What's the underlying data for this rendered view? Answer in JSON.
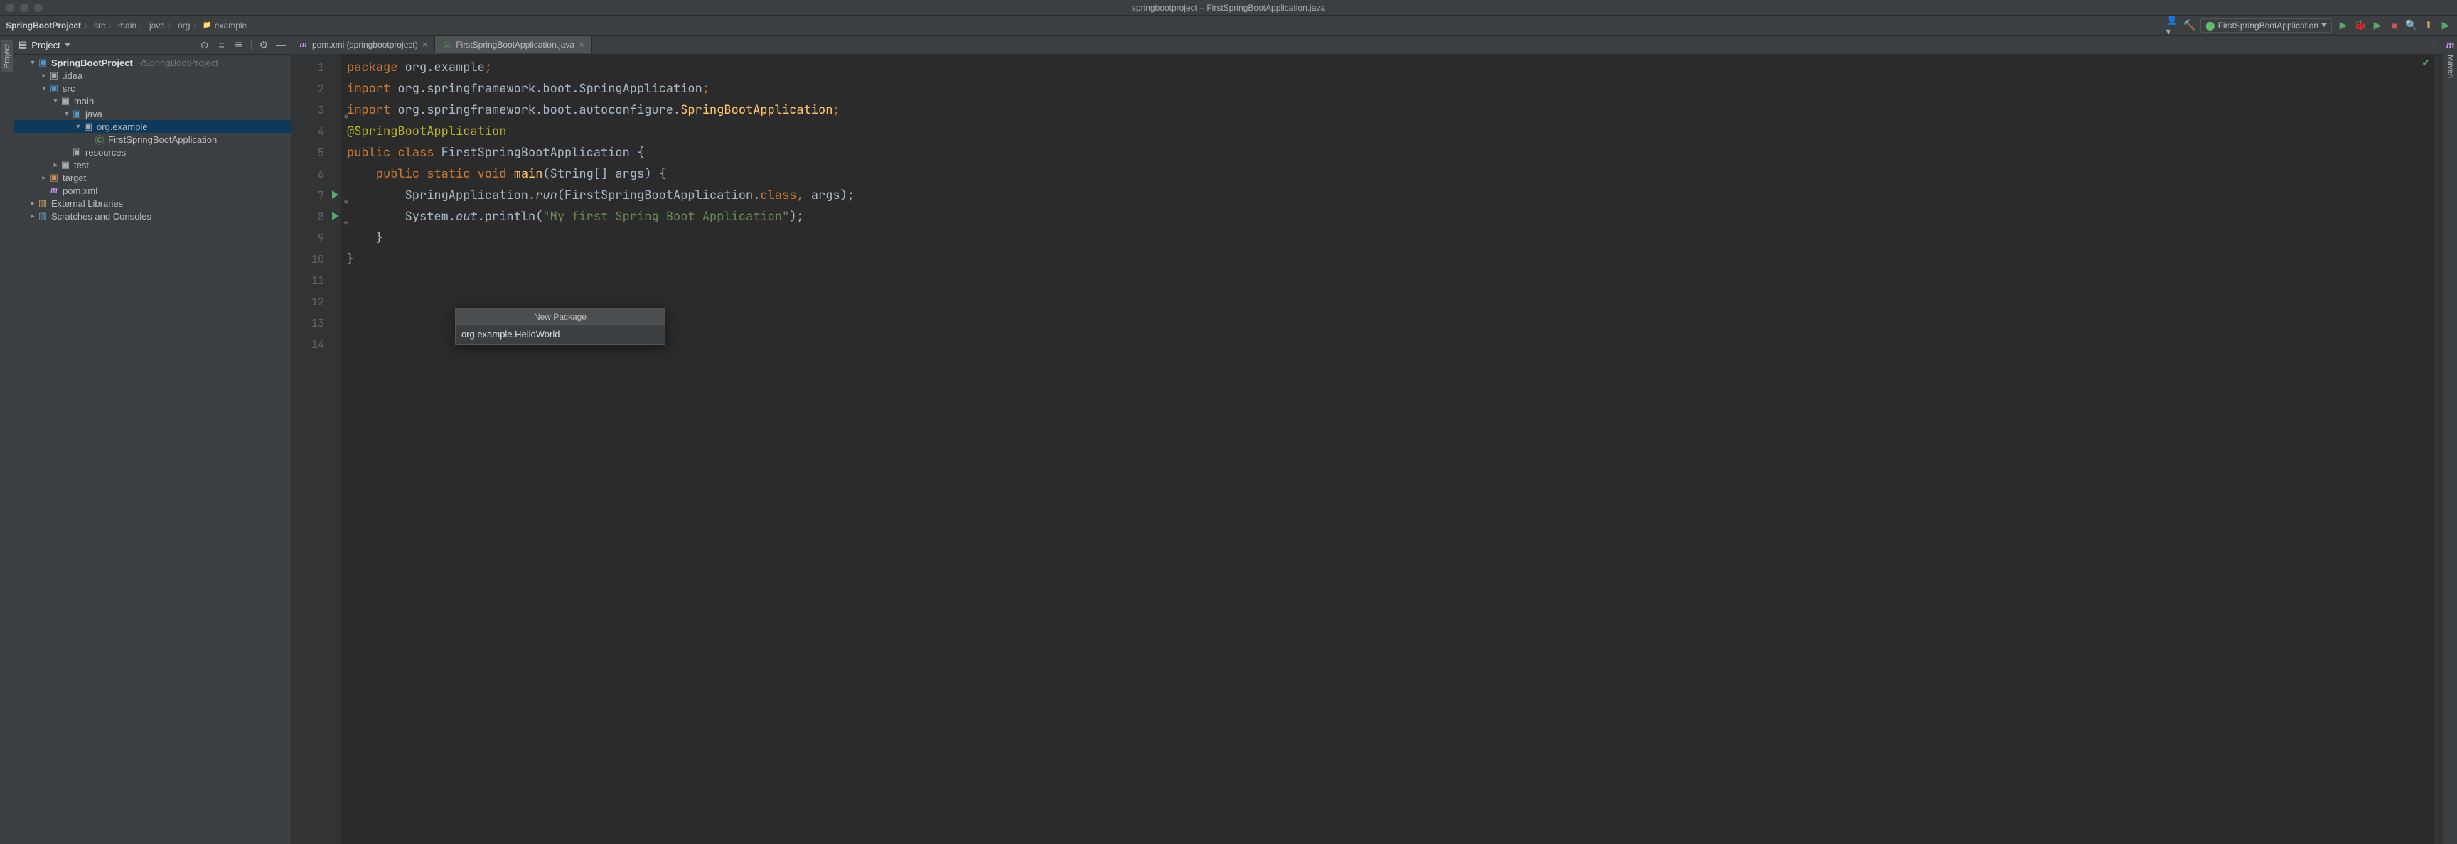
{
  "window": {
    "title": "springbootproject – FirstSpringBootApplication.java"
  },
  "breadcrumb": [
    {
      "label": "SpringBootProject",
      "bold": true
    },
    {
      "label": "src"
    },
    {
      "label": "main"
    },
    {
      "label": "java"
    },
    {
      "label": "org"
    },
    {
      "label": "example",
      "icon": "folder"
    }
  ],
  "run_config": {
    "label": "FirstSpringBootApplication"
  },
  "project_panel": {
    "title": "Project"
  },
  "tree": [
    {
      "depth": 0,
      "toggle": "open",
      "icon": "folder-blue",
      "label": "SpringBootProject",
      "bold": true,
      "hint": "~/SpringBootProject"
    },
    {
      "depth": 1,
      "toggle": "closed",
      "icon": "folder",
      "label": ".idea"
    },
    {
      "depth": 1,
      "toggle": "open",
      "icon": "folder-blue",
      "label": "src"
    },
    {
      "depth": 2,
      "toggle": "open",
      "icon": "folder",
      "label": "main"
    },
    {
      "depth": 3,
      "toggle": "open",
      "icon": "folder-blue",
      "label": "java"
    },
    {
      "depth": 4,
      "toggle": "open",
      "icon": "folder",
      "label": "org.example",
      "sel": true
    },
    {
      "depth": 5,
      "toggle": "",
      "icon": "class",
      "label": "FirstSpringBootApplication"
    },
    {
      "depth": 3,
      "toggle": "",
      "icon": "folder",
      "label": "resources"
    },
    {
      "depth": 2,
      "toggle": "closed",
      "icon": "folder",
      "label": "test"
    },
    {
      "depth": 1,
      "toggle": "closed",
      "icon": "folder-orange",
      "label": "target"
    },
    {
      "depth": 1,
      "toggle": "",
      "icon": "maven",
      "label": "pom.xml"
    },
    {
      "depth": 0,
      "toggle": "closed",
      "icon": "lib",
      "label": "External Libraries"
    },
    {
      "depth": 0,
      "toggle": "closed",
      "icon": "scratch",
      "label": "Scratches and Consoles"
    }
  ],
  "tabs": [
    {
      "label": "pom.xml (springbootproject)",
      "icon": "maven",
      "active": false
    },
    {
      "label": "FirstSpringBootApplication.java",
      "icon": "class",
      "active": true
    }
  ],
  "left_strip": {
    "tab": "Project"
  },
  "right_strip": {
    "tab": "Maven"
  },
  "code": {
    "lines": [
      {
        "n": 1,
        "tokens": [
          {
            "t": "package ",
            "c": "c-kw"
          },
          {
            "t": "org.example",
            "c": "c-pkg"
          },
          {
            "t": ";",
            "c": "c-se"
          }
        ]
      },
      {
        "n": 2,
        "tokens": []
      },
      {
        "n": 3,
        "fold": "⊖",
        "tokens": [
          {
            "t": "import ",
            "c": "c-kw"
          },
          {
            "t": "org.springframework.boot.SpringApplication",
            "c": "c-pkg"
          },
          {
            "t": ";",
            "c": "c-se"
          }
        ]
      },
      {
        "n": 4,
        "tokens": [
          {
            "t": "import ",
            "c": "c-kw"
          },
          {
            "t": "org.springframework.boot.autoconfigure.",
            "c": "c-pkg"
          },
          {
            "t": "SpringBootApplication",
            "c": "c-mnm"
          },
          {
            "t": ";",
            "c": "c-se"
          }
        ]
      },
      {
        "n": 5,
        "tokens": []
      },
      {
        "n": 6,
        "tokens": [
          {
            "t": "@SpringBootApplication",
            "c": "c-ann"
          }
        ]
      },
      {
        "n": 7,
        "run": true,
        "fold": "⊖",
        "tokens": [
          {
            "t": "public class ",
            "c": "c-kw"
          },
          {
            "t": "FirstSpringBootApplication {",
            "c": "c-id"
          }
        ]
      },
      {
        "n": 8,
        "run": true,
        "fold": "⊖",
        "tokens": [
          {
            "t": "    ",
            "c": ""
          },
          {
            "t": "public static void ",
            "c": "c-kw"
          },
          {
            "t": "main",
            "c": "c-mnm"
          },
          {
            "t": "(String[] args) {",
            "c": "c-id"
          }
        ]
      },
      {
        "n": 9,
        "tokens": []
      },
      {
        "n": 10,
        "tokens": [
          {
            "t": "        SpringApplication.",
            "c": "c-id"
          },
          {
            "t": "run",
            "c": "c-id c-it"
          },
          {
            "t": "(FirstSpringBootApplication.",
            "c": "c-id"
          },
          {
            "t": "class",
            "c": "c-kw"
          },
          {
            "t": ", ",
            "c": "c-se"
          },
          {
            "t": "args);",
            "c": "c-id"
          }
        ]
      },
      {
        "n": 11,
        "tokens": [
          {
            "t": "        System.",
            "c": "c-id"
          },
          {
            "t": "out",
            "c": "c-id c-it"
          },
          {
            "t": ".println(",
            "c": "c-id"
          },
          {
            "t": "\"My first Spring Boot Application\"",
            "c": "c-str"
          },
          {
            "t": ");",
            "c": "c-id"
          }
        ]
      },
      {
        "n": 12,
        "tokens": [
          {
            "t": "    }",
            "c": "c-id"
          }
        ]
      },
      {
        "n": 13,
        "tokens": [
          {
            "t": "}",
            "c": "c-id"
          }
        ]
      },
      {
        "n": 14,
        "tokens": []
      }
    ]
  },
  "popup": {
    "title": "New Package",
    "value": "org.example.HelloWorld"
  }
}
